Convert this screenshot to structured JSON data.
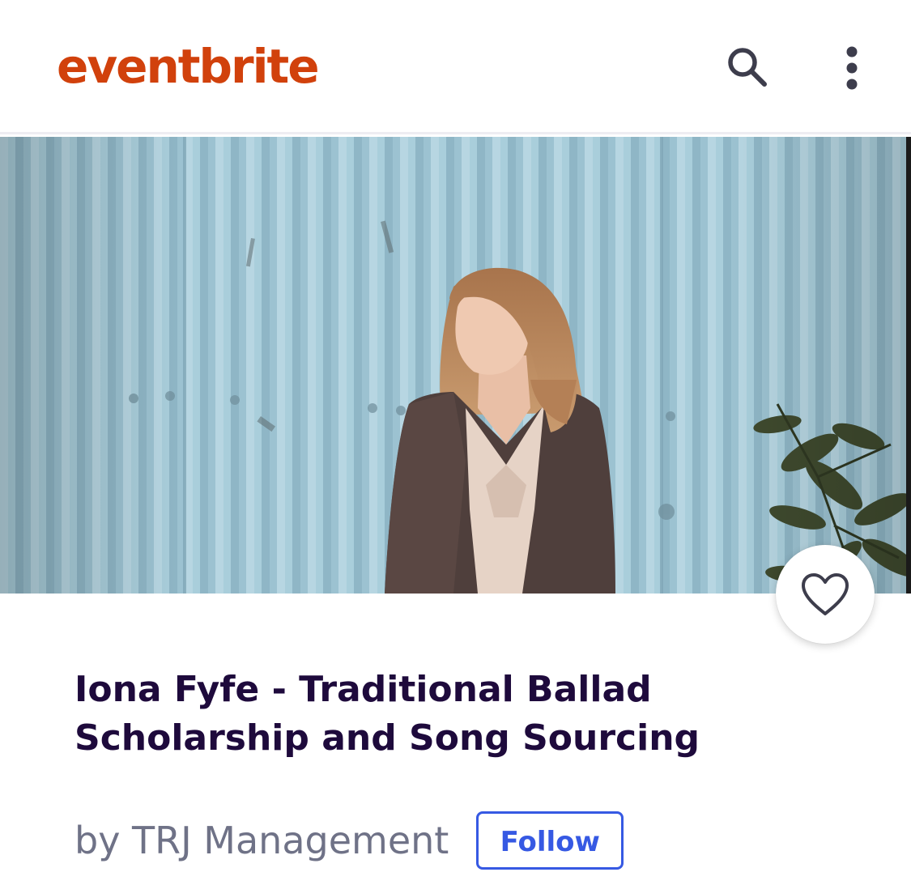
{
  "header": {
    "logo_text": "eventbrite",
    "search_icon": "search-icon",
    "more_icon": "more-vertical-icon"
  },
  "event": {
    "image_alt": "Event cover photo",
    "title": "Iona Fyfe - Traditional Ballad Scholarship and Song Sourcing",
    "organizer": "by TRJ Management",
    "follow_label": "Follow",
    "like_icon": "heart-icon"
  },
  "colors": {
    "brand": "#d1410c",
    "title": "#1e0a3c",
    "organizer": "#6f7287",
    "follow": "#3659e3"
  }
}
